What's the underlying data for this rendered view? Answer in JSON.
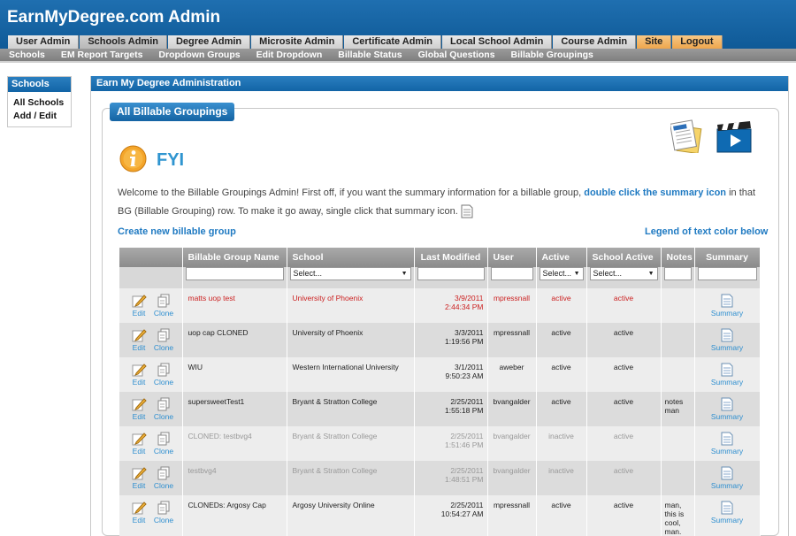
{
  "header": {
    "title": "EarnMyDegree.com Admin"
  },
  "tabs": [
    {
      "label": "User Admin"
    },
    {
      "label": "Schools Admin"
    },
    {
      "label": "Degree Admin"
    },
    {
      "label": "Microsite Admin"
    },
    {
      "label": "Certificate Admin"
    },
    {
      "label": "Local School Admin"
    },
    {
      "label": "Course Admin"
    },
    {
      "label": "Site"
    },
    {
      "label": "Logout"
    }
  ],
  "subnav": [
    {
      "label": "Schools"
    },
    {
      "label": "EM Report Targets"
    },
    {
      "label": "Dropdown Groups"
    },
    {
      "label": "Edit Dropdown"
    },
    {
      "label": "Billable Status"
    },
    {
      "label": "Global Questions"
    },
    {
      "label": "Billable Groupings"
    }
  ],
  "left": {
    "title": "Schools",
    "links": [
      {
        "label": "All Schools"
      },
      {
        "label": "Add / Edit"
      }
    ]
  },
  "main": {
    "title": "Earn My Degree Administration",
    "section_title": "All Billable Groupings",
    "fyi_title": "FYI",
    "desc_part1": "Welcome to the Billable Groupings Admin! First off, if you want the summary information for a billable group, ",
    "desc_strong": "double click the summary icon",
    "desc_part2": " in that BG (Billable Grouping) row. To make it go away, single click that summary icon.",
    "create_link": "Create new billable group",
    "legend_link": "Legend of text color below"
  },
  "table": {
    "headers": [
      "Billable Group Name",
      "School",
      "Last Modified",
      "User",
      "Active",
      "School Active",
      "Notes",
      "Summary"
    ],
    "filters": {
      "school": "Select...",
      "active": "Select...",
      "school_active": "Select..."
    },
    "edit_label": "Edit",
    "clone_label": "Clone",
    "summary_label": "Summary",
    "rows": [
      {
        "name": "matts uop test",
        "school": "University of Phoenix",
        "date": "3/9/2011",
        "time": "2:44:34 PM",
        "user": "mpressnall",
        "active": "active",
        "school_active": "active",
        "notes": "",
        "style": "red"
      },
      {
        "name": "uop cap CLONED",
        "school": "University of Phoenix",
        "date": "3/3/2011",
        "time": "1:19:56 PM",
        "user": "mpressnall",
        "active": "active",
        "school_active": "active",
        "notes": "",
        "style": "normal"
      },
      {
        "name": "WIU",
        "school": "Western International University",
        "date": "3/1/2011",
        "time": "9:50:23 AM",
        "user": "aweber",
        "active": "active",
        "school_active": "active",
        "notes": "",
        "style": "normal"
      },
      {
        "name": "supersweetTest1",
        "school": "Bryant & Stratton College",
        "date": "2/25/2011",
        "time": "1:55:18 PM",
        "user": "bvangalder",
        "active": "active",
        "school_active": "active",
        "notes": "notes man",
        "style": "normal"
      },
      {
        "name": "CLONED: testbvg4",
        "school": "Bryant & Stratton College",
        "date": "2/25/2011",
        "time": "1:51:46 PM",
        "user": "bvangalder",
        "active": "inactive",
        "school_active": "active",
        "notes": "",
        "style": "gray"
      },
      {
        "name": "testbvg4",
        "school": "Bryant & Stratton College",
        "date": "2/25/2011",
        "time": "1:48:51 PM",
        "user": "bvangalder",
        "active": "inactive",
        "school_active": "active",
        "notes": "",
        "style": "gray"
      },
      {
        "name": "CLONEDs: Argosy Cap",
        "school": "Argosy University Online",
        "date": "2/25/2011",
        "time": "10:54:27 AM",
        "user": "mpressnall",
        "active": "active",
        "school_active": "active",
        "notes": "man, this is cool, man.",
        "style": "normal"
      }
    ]
  }
}
